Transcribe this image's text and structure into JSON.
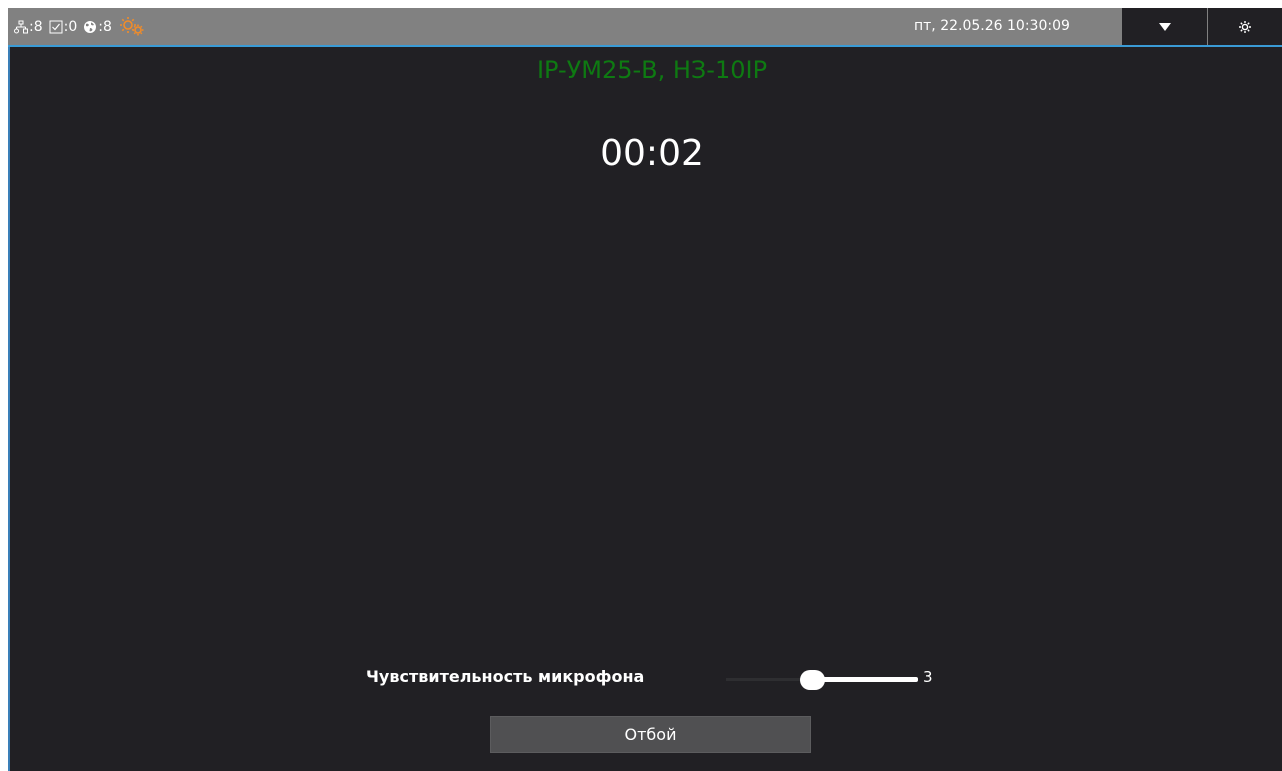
{
  "status_bar": {
    "network_count": "8",
    "tasks_count": "0",
    "globe_count": "8",
    "network_icon": "network-nodes-icon",
    "tasks_icon": "checkbox-icon",
    "globe_icon": "globe-icon",
    "warning_icon": "settings-warning-icon",
    "warning_color": "#f28c28",
    "datetime": "пт, 22.05.26 10:30:09",
    "dropdown_icon": "chevron-down-icon",
    "settings_icon": "gear-icon"
  },
  "call": {
    "title": "IP-УМ25-В, НЗ-10IP",
    "title_color": "#0e7a12",
    "timer": "00:02"
  },
  "mic_sensitivity": {
    "label": "Чувствительность микрофона",
    "value": "3",
    "level_fraction": 0.45
  },
  "hangup_button": {
    "label": "Отбой"
  },
  "colors": {
    "background": "#212024",
    "topbar": "#818181",
    "accent_line": "#3a9bd6"
  }
}
